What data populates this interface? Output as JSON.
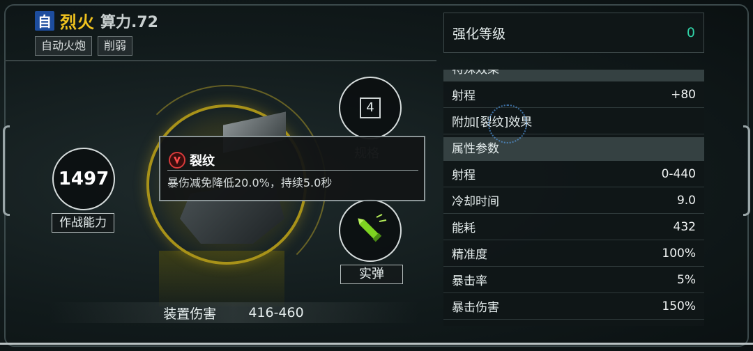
{
  "header": {
    "auto_badge": "自",
    "weapon_name": "烈火",
    "power_text": "算力.72",
    "tags": [
      "自动火炮",
      "削弱"
    ]
  },
  "stats": {
    "combat_power_value": "1497",
    "combat_power_label": "作战能力",
    "spec_value": "4",
    "spec_label": "规格",
    "ammo_label": "实弹",
    "damage_label": "装置伤害",
    "damage_value": "416-460"
  },
  "tooltip": {
    "title": "裂纹",
    "description": "暴伤减免降低20.0%，持续5.0秒"
  },
  "right_panel": {
    "enhance_label": "强化等级",
    "enhance_value": "0",
    "special_title": "特殊效果",
    "special_rows": [
      {
        "label": "射程",
        "value": "+80"
      },
      {
        "label": "附加[裂纹]效果",
        "value": ""
      }
    ],
    "params_title": "属性参数",
    "param_rows": [
      {
        "label": "射程",
        "value": "0-440"
      },
      {
        "label": "冷却时间",
        "value": "9.0"
      },
      {
        "label": "能耗",
        "value": "432"
      },
      {
        "label": "精准度",
        "value": "100%"
      },
      {
        "label": "暴击率",
        "value": "5%"
      },
      {
        "label": "暴击伤害",
        "value": "150%"
      }
    ]
  },
  "colors": {
    "accent_gold": "#f0c21e",
    "enhance_green": "#30d2a7",
    "auto_badge_blue": "#1d4d9e"
  }
}
